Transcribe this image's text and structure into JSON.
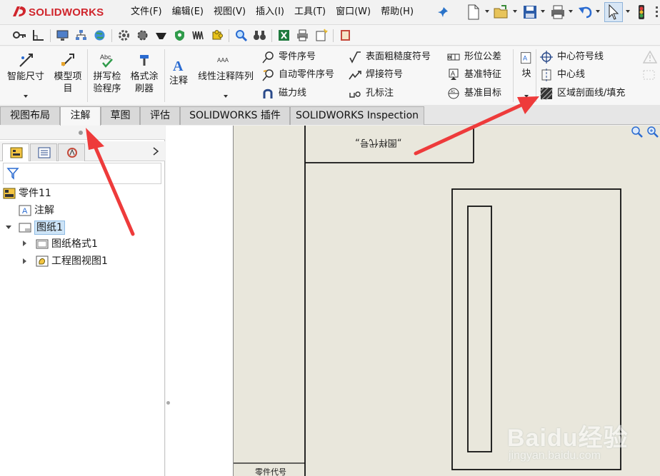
{
  "app": {
    "brand": "SOLIDWORKS",
    "menu": [
      "文件(F)",
      "编辑(E)",
      "视图(V)",
      "插入(I)",
      "工具(T)",
      "窗口(W)",
      "帮助(H)"
    ]
  },
  "ribbon": {
    "smart_dimension": "智能尺寸",
    "model_items_line1": "模型项",
    "model_items_line2": "目",
    "spell_check_line1": "拼写检",
    "spell_check_line2": "验程序",
    "format_painter_line1": "格式涂",
    "format_painter_line2": "刷器",
    "note": "注释",
    "linear_note_pattern": "线性注释阵列",
    "balloon": "零件序号",
    "auto_balloon": "自动零件序号",
    "magnetic_line": "磁力线",
    "surface_finish": "表面粗糙度符号",
    "weld_symbol": "焊接符号",
    "hole_callout": "孔标注",
    "geometric_tolerance": "形位公差",
    "datum_feature": "基准特征",
    "datum_target": "基准目标",
    "block": "块",
    "center_mark": "中心符号线",
    "centerline": "中心线",
    "area_hatch": "区域剖面线/填充"
  },
  "tabs": [
    "视图布局",
    "注解",
    "草图",
    "评估",
    "SOLIDWORKS 插件",
    "SOLIDWORKS Inspection"
  ],
  "active_tab": "注解",
  "tree": {
    "root": "零件11",
    "annotations": "注解",
    "sheet": "图纸1",
    "sheet_format": "图纸格式1",
    "drawing_view": "工程图视图1"
  },
  "drawing": {
    "title_block_text": "„图样代号„",
    "part_code_label": "零件代号"
  },
  "watermark": {
    "main": "Baidu经验",
    "url": "jingyan.baidu.com"
  },
  "colors": {
    "brand_red": "#d0252c",
    "sheet_bg": "#e9e7dc",
    "arrow_red": "#ee3b3b"
  }
}
